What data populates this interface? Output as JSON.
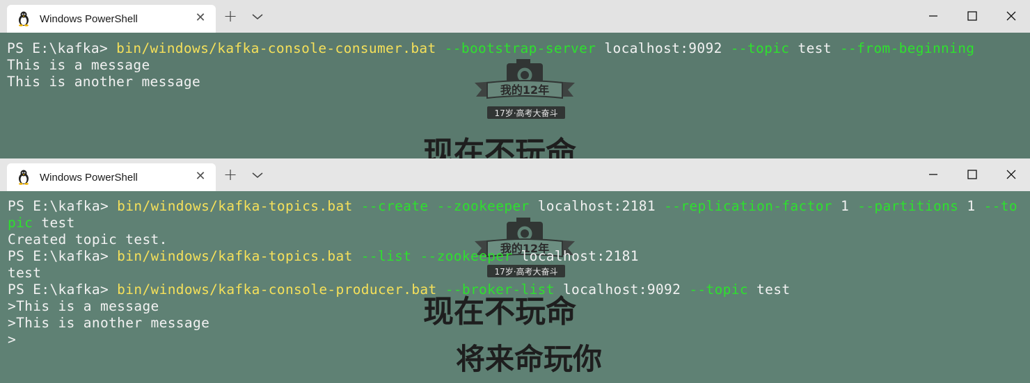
{
  "colors": {
    "terminal_bg": "#5a7a6e",
    "prompt_text": "#f2f2f2",
    "command_yellow": "#f5e05a",
    "flag_green": "#2ee02e",
    "tab_bg": "#ffffff",
    "titlebar_bg": "#e6e6e6"
  },
  "windows": [
    {
      "tab_title": "Windows PowerShell",
      "icons": {
        "tab": "linux-penguin-icon",
        "close": "close-icon",
        "new_tab": "plus-icon",
        "dropdown": "chevron-down-icon"
      },
      "lines": [
        [
          {
            "t": "PS E:\\kafka> ",
            "c": "w"
          },
          {
            "t": "bin/windows/kafka-console-consumer.bat",
            "c": "y"
          },
          {
            "t": " ",
            "c": "w"
          },
          {
            "t": "--bootstrap-server",
            "c": "g"
          },
          {
            "t": " localhost:9092 ",
            "c": "w"
          },
          {
            "t": "--topic",
            "c": "g"
          },
          {
            "t": " test ",
            "c": "w"
          },
          {
            "t": "--from-beginning",
            "c": "g"
          }
        ],
        [
          {
            "t": "This is a message",
            "c": "w"
          }
        ],
        [
          {
            "t": "This is another message",
            "c": "w"
          }
        ]
      ]
    },
    {
      "tab_title": "Windows PowerShell",
      "icons": {
        "tab": "linux-penguin-icon",
        "close": "close-icon",
        "new_tab": "plus-icon",
        "dropdown": "chevron-down-icon"
      },
      "lines": [
        [
          {
            "t": "PS E:\\kafka> ",
            "c": "w"
          },
          {
            "t": "bin/windows/kafka-topics.bat",
            "c": "y"
          },
          {
            "t": " ",
            "c": "w"
          },
          {
            "t": "--create",
            "c": "g"
          },
          {
            "t": " ",
            "c": "w"
          },
          {
            "t": "--zookeeper",
            "c": "g"
          },
          {
            "t": " localhost:2181 ",
            "c": "w"
          },
          {
            "t": "--replication-factor",
            "c": "g"
          },
          {
            "t": " 1 ",
            "c": "w"
          },
          {
            "t": "--partitions",
            "c": "g"
          },
          {
            "t": " 1 ",
            "c": "w"
          },
          {
            "t": "--to",
            "c": "g"
          }
        ],
        [
          {
            "t": "pic",
            "c": "g"
          },
          {
            "t": " test",
            "c": "w"
          }
        ],
        [
          {
            "t": "Created topic test.",
            "c": "w"
          }
        ],
        [
          {
            "t": "PS E:\\kafka> ",
            "c": "w"
          },
          {
            "t": "bin/windows/kafka-topics.bat",
            "c": "y"
          },
          {
            "t": " ",
            "c": "w"
          },
          {
            "t": "--list",
            "c": "g"
          },
          {
            "t": " ",
            "c": "w"
          },
          {
            "t": "--zookeeper",
            "c": "g"
          },
          {
            "t": " localhost:2181",
            "c": "w"
          }
        ],
        [
          {
            "t": "test",
            "c": "w"
          }
        ],
        [
          {
            "t": "PS E:\\kafka> ",
            "c": "w"
          },
          {
            "t": "bin/windows/kafka-console-producer.bat",
            "c": "y"
          },
          {
            "t": " ",
            "c": "w"
          },
          {
            "t": "--broker-list",
            "c": "g"
          },
          {
            "t": " localhost:9092 ",
            "c": "w"
          },
          {
            "t": "--topic",
            "c": "g"
          },
          {
            "t": " test",
            "c": "w"
          }
        ],
        [
          {
            "t": ">This is a message",
            "c": "w"
          }
        ],
        [
          {
            "t": ">This is another message",
            "c": "w"
          }
        ],
        [
          {
            "t": ">",
            "c": "w"
          }
        ]
      ]
    }
  ],
  "wallpaper": {
    "badge_ribbon_text": "我的12年",
    "badge_caption": "17岁·高考大奋斗",
    "slogan_1": "现在不玩命",
    "slogan_2": "将来命玩你"
  }
}
